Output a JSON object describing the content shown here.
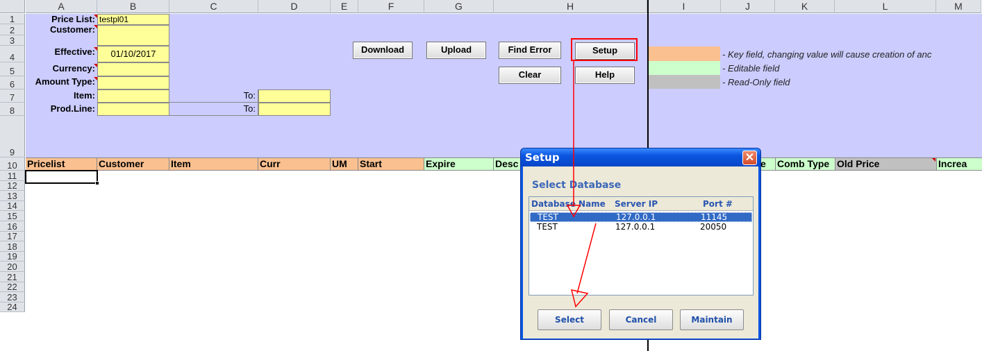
{
  "columns": [
    "A",
    "B",
    "C",
    "D",
    "E",
    "F",
    "G",
    "H",
    "I",
    "J",
    "K",
    "L",
    "M"
  ],
  "rows": [
    "1",
    "2",
    "3",
    "4",
    "5",
    "6",
    "7",
    "8",
    "9",
    "10",
    "11",
    "12",
    "13",
    "14",
    "15",
    "16",
    "17",
    "18",
    "19",
    "20",
    "21",
    "22",
    "23",
    "24"
  ],
  "form": {
    "price_list_label": "Price List:",
    "price_list_value": "testpl01",
    "customer_label": "Customer:",
    "effective_label": "Effective:",
    "effective_value": "01/10/2017",
    "currency_label": "Currency:",
    "amount_type_label": "Amount Type:",
    "item_label": "Item:",
    "prodline_label": "Prod.Line:",
    "to_label_1": "To:",
    "to_label_2": "To:"
  },
  "buttons": {
    "download": "Download",
    "upload": "Upload",
    "find_error": "Find Error",
    "setup": "Setup",
    "clear": "Clear",
    "help": "Help"
  },
  "legend": {
    "key_text": "- Key field, changing value will cause creation of anc",
    "editable_text": "- Editable field",
    "readonly_text": "- Read-Only field",
    "colors": {
      "key": "#fac090",
      "editable": "#ccffcc",
      "readonly": "#c0c0c0"
    }
  },
  "header_row": {
    "pricelist": "Pricelist",
    "customer": "Customer",
    "item": "Item",
    "curr": "Curr",
    "um": "UM",
    "start": "Start",
    "expire": "Expire",
    "desc": "Desc",
    "e_frag": "e",
    "comb_type": "Comb Type",
    "old_price": "Old Price",
    "increa": "Increa"
  },
  "dialog": {
    "title": "Setup",
    "close_icon": "close-icon",
    "section_title": "Select Database",
    "col_db": "Database Name",
    "col_ip": "Server IP",
    "col_port": "Port #",
    "rows": [
      {
        "db": "TEST",
        "ip": "127.0.0.1",
        "port": "11145"
      },
      {
        "db": "TEST",
        "ip": "127.0.0.1",
        "port": "20050"
      }
    ],
    "select": "Select",
    "cancel": "Cancel",
    "maintain": "Maintain"
  }
}
